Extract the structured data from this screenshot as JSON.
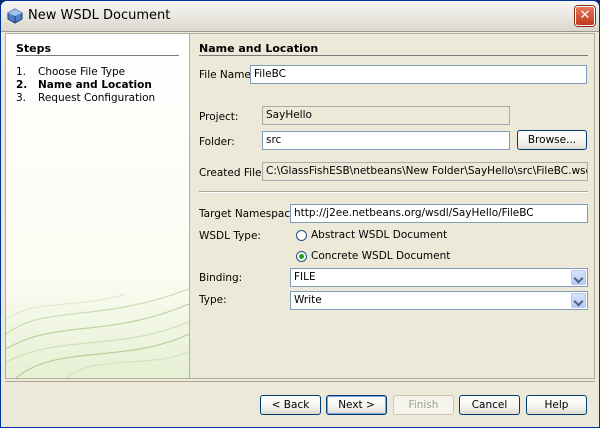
{
  "window": {
    "title": "New WSDL Document",
    "close_label": "✕"
  },
  "steps": {
    "title": "Steps",
    "items": [
      {
        "num": "1.",
        "label": "Choose File Type"
      },
      {
        "num": "2.",
        "label": "Name and Location"
      },
      {
        "num": "3.",
        "label": "Request Configuration"
      }
    ]
  },
  "main": {
    "title": "Name and Location",
    "file_name": {
      "label": "File Name:",
      "value": "FileBC"
    },
    "project": {
      "label": "Project:",
      "value": "SayHello"
    },
    "folder": {
      "label": "Folder:",
      "value": "src",
      "browse_label": "Browse..."
    },
    "created_file": {
      "label": "Created File:",
      "value": "C:\\GlassFishESB\\netbeans\\New Folder\\SayHello\\src\\FileBC.wsdl"
    },
    "target_namespace": {
      "label": "Target Namespace:",
      "value": "http://j2ee.netbeans.org/wsdl/SayHello/FileBC"
    },
    "wsdl_type": {
      "label": "WSDL Type:",
      "abstract_label": "Abstract WSDL Document",
      "concrete_label": "Concrete WSDL Document",
      "selected": "concrete"
    },
    "binding": {
      "label": "Binding:",
      "value": "FILE"
    },
    "type": {
      "label": "Type:",
      "value": "Write"
    }
  },
  "footer": {
    "back": "< Back",
    "next": "Next >",
    "finish": "Finish",
    "cancel": "Cancel",
    "help": "Help"
  },
  "colors": {
    "titlebar_border": "#003399",
    "accent_radio": "#21a121",
    "button_border": "#003c74"
  }
}
